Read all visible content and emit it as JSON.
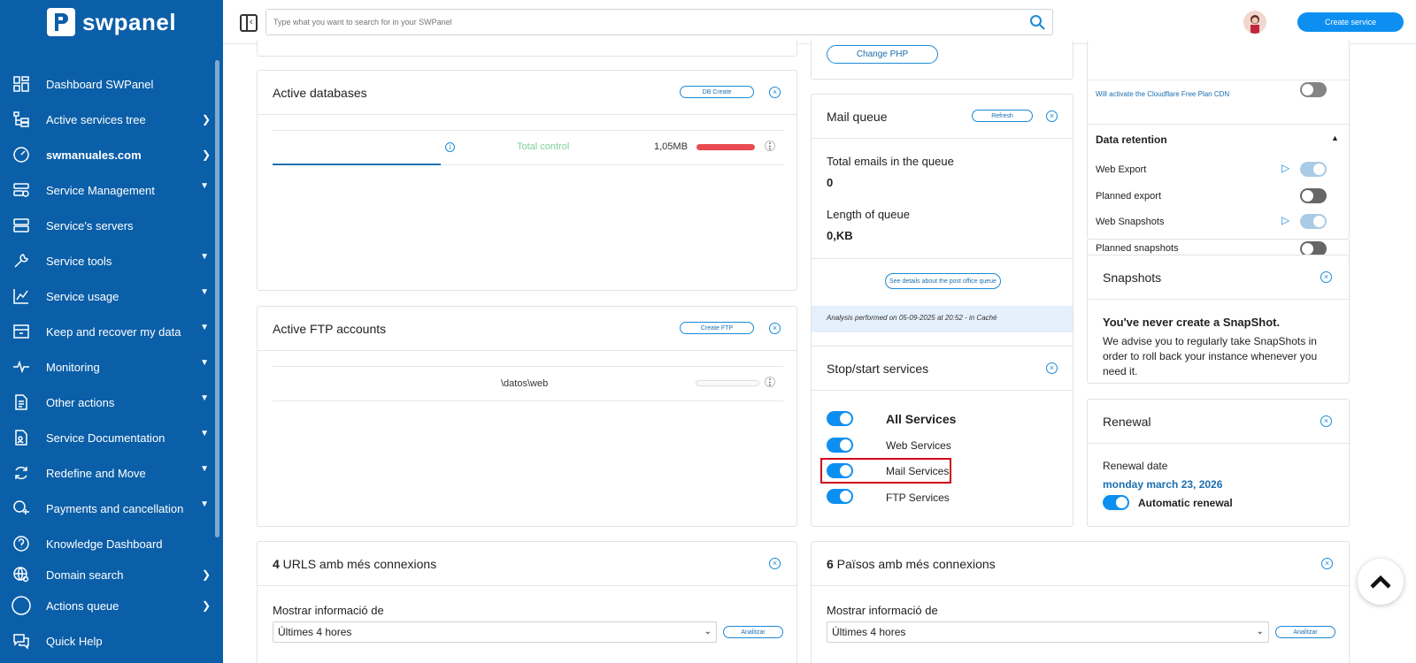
{
  "app": {
    "logo_text": "swpanel"
  },
  "sidebar": {
    "items": [
      {
        "label": "Dashboard SWPanel",
        "icon": "dashboard-icon"
      },
      {
        "label": "Active services tree",
        "icon": "tree-icon"
      },
      {
        "label": "swmanuales.com",
        "icon": "gauge-icon"
      },
      {
        "label": "Service Management",
        "icon": "server-gear-icon"
      },
      {
        "label": "Service's servers",
        "icon": "servers-icon"
      },
      {
        "label": "Service tools",
        "icon": "wrench-icon"
      },
      {
        "label": "Service usage",
        "icon": "chart-icon"
      },
      {
        "label": "Keep and recover my data",
        "icon": "archive-icon"
      },
      {
        "label": "Monitoring",
        "icon": "pulse-icon"
      },
      {
        "label": "Other actions",
        "icon": "document-icon"
      },
      {
        "label": "Service Documentation",
        "icon": "doc-user-icon"
      },
      {
        "label": "Redefine and Move",
        "icon": "refresh-icon"
      },
      {
        "label": "Payments and cancellation",
        "icon": "payment-icon"
      },
      {
        "label": "Knowledge Dashboard",
        "icon": "question-icon"
      },
      {
        "label": "Domain search",
        "icon": "globe-search-icon"
      },
      {
        "label": "Actions queue",
        "icon": "circle-icon"
      },
      {
        "label": "Quick Help",
        "icon": "chat-icon"
      }
    ]
  },
  "topbar": {
    "search_placeholder": "Type what you want to search for in your SWPanel",
    "create_service": "Create service"
  },
  "cards": {
    "php": {
      "change_php": "Change PHP"
    },
    "databases": {
      "title": "Active databases",
      "button": "DB Create",
      "row": {
        "type": "Total control",
        "size": "1,05MB"
      }
    },
    "ftp": {
      "title": "Active FTP accounts",
      "button": "Create FTP",
      "row": {
        "path": "\\datos\\web"
      }
    },
    "mail_queue": {
      "title": "Mail queue",
      "button": "Refresh",
      "total_label": "Total emails in the queue",
      "total_value": "0",
      "length_label": "Length of queue",
      "length_value": "0,KB",
      "details_button": "See details about the post office queue",
      "analysis_note": "Analysis performed on 05-09-2025 at 20:52 - in Caché"
    },
    "services": {
      "title": "Stop/start services",
      "items": [
        {
          "label": "All Services",
          "on": true
        },
        {
          "label": "Web Services",
          "on": true
        },
        {
          "label": "Mail Services",
          "on": true
        },
        {
          "label": "FTP Services",
          "on": true
        }
      ]
    },
    "cloudflare": {
      "note": "Will activate the Cloudflare Free Plan CDN"
    },
    "data_retention": {
      "title": "Data retention",
      "items": [
        {
          "label": "Web Export",
          "on": true
        },
        {
          "label": "Planned export",
          "on": false
        },
        {
          "label": "Web Snapshots",
          "on": true
        },
        {
          "label": "Planned snapshots",
          "on": false
        }
      ]
    },
    "snapshots": {
      "title": "Snapshots",
      "headline": "You've never create a SnapShot.",
      "body": "We advise you to regularly take SnapShots in order to roll back your instance whenever you need it."
    },
    "renewal": {
      "title": "Renewal",
      "date_label": "Renewal date",
      "date_value": "monday march 23, 2026",
      "auto_label": "Automatic renewal"
    },
    "urls": {
      "count": "4",
      "title_rest": " URLS amb més connexions",
      "show_label": "Mostrar informació de",
      "select_value": "Últimes 4 hores",
      "analyze": "Analitzar"
    },
    "countries": {
      "count": "6",
      "title_rest": " Països amb més connexions",
      "show_label": "Mostrar informació de",
      "select_value": "Últimes 4 hores",
      "analyze": "Analitzar"
    }
  },
  "colors": {
    "sidebar": "#0b5fa8",
    "accent": "#0c8ff0",
    "highlight": "#d0021b",
    "progress": "#e84a4f",
    "db_type": "#7fcf9f"
  }
}
